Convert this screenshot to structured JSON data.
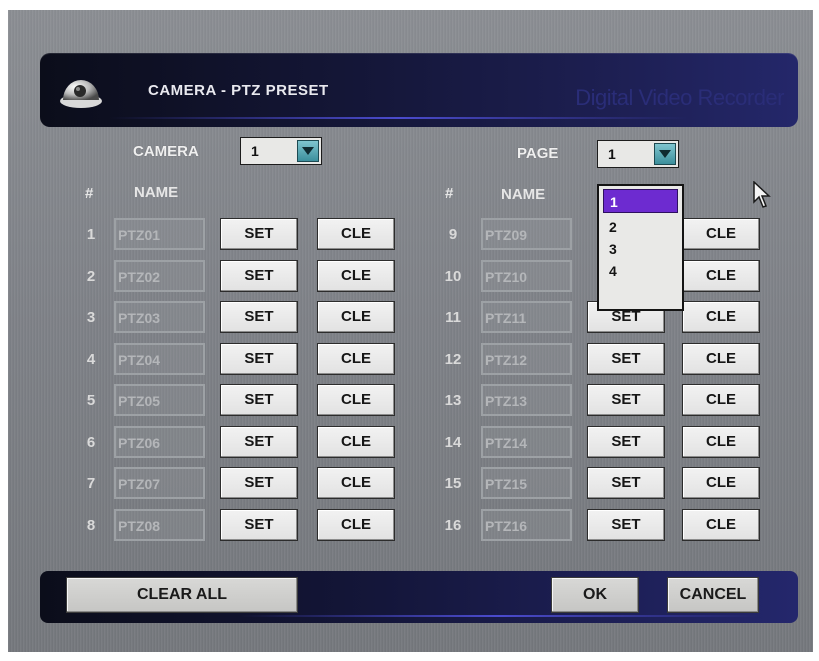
{
  "header": {
    "title": "CAMERA - PTZ PRESET",
    "brand": "Digital Video Recorder",
    "logo_icon": "dome-camera-icon"
  },
  "camera_select": {
    "label": "CAMERA",
    "value": "1"
  },
  "page_select": {
    "label": "PAGE",
    "value": "1",
    "options": [
      "1",
      "2",
      "3",
      "4"
    ],
    "highlighted": "1"
  },
  "columns": {
    "number": "#",
    "name": "NAME"
  },
  "presets": [
    {
      "num": "1",
      "name": "PTZ01"
    },
    {
      "num": "2",
      "name": "PTZ02"
    },
    {
      "num": "3",
      "name": "PTZ03"
    },
    {
      "num": "4",
      "name": "PTZ04"
    },
    {
      "num": "5",
      "name": "PTZ05"
    },
    {
      "num": "6",
      "name": "PTZ06"
    },
    {
      "num": "7",
      "name": "PTZ07"
    },
    {
      "num": "8",
      "name": "PTZ08"
    },
    {
      "num": "9",
      "name": "PTZ09"
    },
    {
      "num": "10",
      "name": "PTZ10"
    },
    {
      "num": "11",
      "name": "PTZ11"
    },
    {
      "num": "12",
      "name": "PTZ12"
    },
    {
      "num": "13",
      "name": "PTZ13"
    },
    {
      "num": "14",
      "name": "PTZ14"
    },
    {
      "num": "15",
      "name": "PTZ15"
    },
    {
      "num": "16",
      "name": "PTZ16"
    }
  ],
  "row_buttons": {
    "set": "SET",
    "clear": "CLE"
  },
  "footer": {
    "clear_all": "CLEAR ALL",
    "ok": "OK",
    "cancel": "CANCEL"
  },
  "colors": {
    "header_dark": "#0b0d1a",
    "header_blue": "#24276a",
    "dropdown_highlight": "#6d2bd0",
    "background_gray": "#7d8086"
  }
}
